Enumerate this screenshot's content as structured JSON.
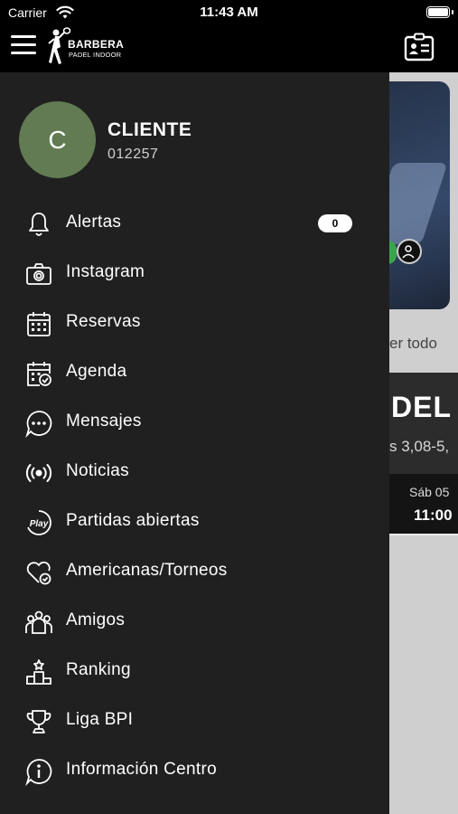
{
  "status_bar": {
    "carrier": "Carrier",
    "time": "11:43 AM"
  },
  "header": {
    "logo_brand": "BARBERA",
    "logo_sub": "PADEL INDOOR",
    "menu_icon": "hamburger-icon",
    "right_icon": "id-card-icon"
  },
  "profile": {
    "avatar_initial": "C",
    "name": "CLIENTE",
    "id": "012257",
    "avatar_color": "#627b52"
  },
  "menu": {
    "items": [
      {
        "label": "Alertas",
        "icon": "bell-icon",
        "badge": "0"
      },
      {
        "label": "Instagram",
        "icon": "camera-icon"
      },
      {
        "label": "Reservas",
        "icon": "calendar-icon"
      },
      {
        "label": "Agenda",
        "icon": "calendar-check-icon"
      },
      {
        "label": "Mensajes",
        "icon": "chat-icon"
      },
      {
        "label": "Noticias",
        "icon": "broadcast-icon"
      },
      {
        "label": "Partidas abiertas",
        "icon": "play-icon"
      },
      {
        "label": "Americanas/Torneos",
        "icon": "heart-check-icon"
      },
      {
        "label": "Amigos",
        "icon": "group-icon"
      },
      {
        "label": "Ranking",
        "icon": "podium-icon"
      },
      {
        "label": "Liga BPI",
        "icon": "trophy-icon"
      },
      {
        "label": "Información Centro",
        "icon": "info-icon"
      }
    ]
  },
  "background": {
    "see_all": "er todo",
    "card_title": "DEL",
    "card_desc": "s 3,08-5,",
    "card_day": "Sáb 05",
    "card_hour": "11:00"
  },
  "colors": {
    "drawer_bg": "#202020",
    "header_bg": "#000000"
  }
}
